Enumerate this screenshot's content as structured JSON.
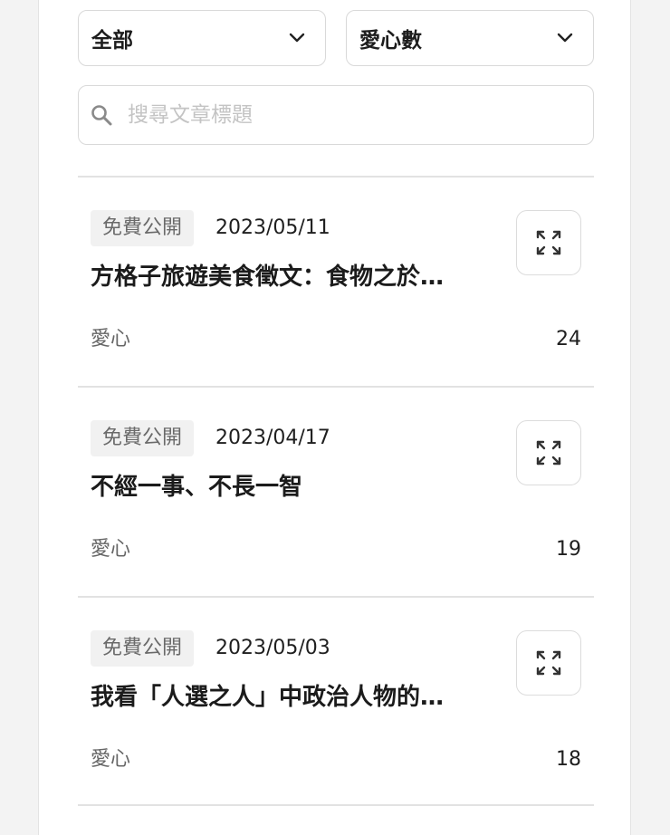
{
  "filters": {
    "category": {
      "value": "全部"
    },
    "sort": {
      "value": "愛心數"
    }
  },
  "search": {
    "placeholder": "搜尋文章標題",
    "value": ""
  },
  "articles": [
    {
      "tag": "免費公開",
      "date": "2023/05/11",
      "title": "方格子旅遊美食徵文：食物之於…",
      "like_label": "愛心",
      "likes": "24"
    },
    {
      "tag": "免費公開",
      "date": "2023/04/17",
      "title": "不經一事、不長一智",
      "like_label": "愛心",
      "likes": "19"
    },
    {
      "tag": "免費公開",
      "date": "2023/05/03",
      "title": "我看「人選之人」中政治人物的…",
      "like_label": "愛心",
      "likes": "18"
    }
  ],
  "icons": {
    "dropdown": "chevron-down-icon",
    "search": "search-icon",
    "expand": "expand-icon"
  },
  "colors": {
    "background": "#f3f3f3",
    "panel": "#ffffff",
    "border": "#d9d9d9",
    "tag_bg": "#f1f1f1",
    "muted_text": "#666666"
  }
}
